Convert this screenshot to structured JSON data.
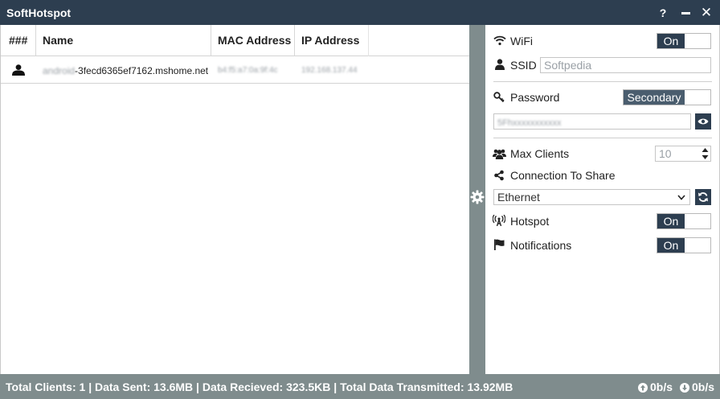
{
  "window": {
    "title": "SoftHotspot",
    "help_label": "?",
    "close_label": "✕"
  },
  "clients_table": {
    "columns": [
      "###",
      "Name",
      "MAC Address",
      "IP Address"
    ],
    "rows": [
      {
        "name_hidden": "android",
        "name_visible": "-3fecd6365ef7162.mshome.net",
        "mac": "b4:f5:a7:0a:9f:4c",
        "ip": "192.168.137.44"
      }
    ]
  },
  "settings": {
    "wifi": {
      "label": "WiFi",
      "state": "On"
    },
    "ssid": {
      "label": "SSID",
      "value": "Softpedia"
    },
    "password": {
      "label": "Password",
      "mode": "Secondary",
      "value": "5Fhxxxxxxxxxxx"
    },
    "max_clients": {
      "label": "Max Clients",
      "value": "10"
    },
    "connection": {
      "label": "Connection To Share",
      "selected": "Ethernet"
    },
    "hotspot": {
      "label": "Hotspot",
      "state": "On"
    },
    "notifications": {
      "label": "Notifications",
      "state": "On"
    }
  },
  "status": {
    "summary": "Total Clients: 1 | Data Sent: 13.6MB | Data Recieved: 323.5KB | Total Data Transmitted: 13.92MB",
    "upload": "0b/s",
    "download": "0b/s"
  },
  "colors": {
    "titlebar": "#2d3e50",
    "statusbar": "#7f8c8d",
    "accent": "#2d3e50"
  }
}
